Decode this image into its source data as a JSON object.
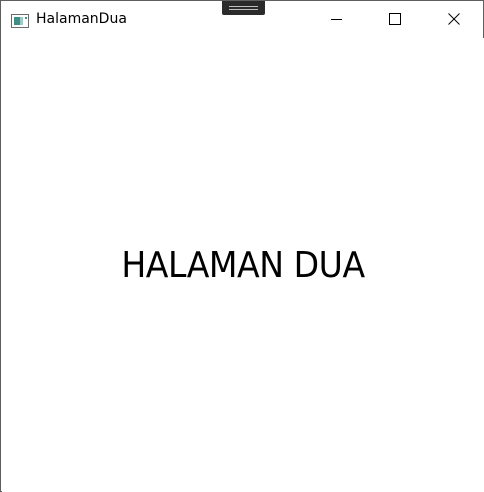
{
  "window": {
    "title": "HalamanDua",
    "app_icon": "window-app-icon",
    "buttons": {
      "minimize": "minimize-icon",
      "maximize": "maximize-icon",
      "close": "close-icon"
    }
  },
  "content": {
    "heading": "HALAMAN DUA"
  }
}
